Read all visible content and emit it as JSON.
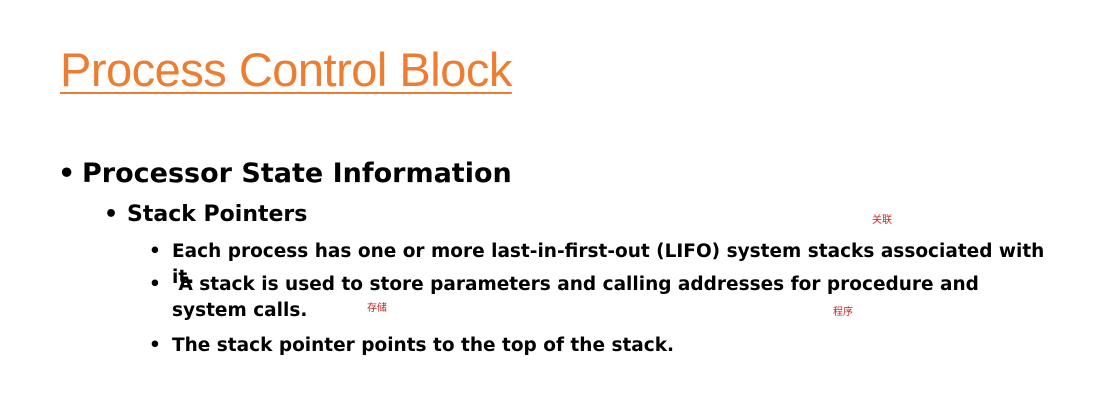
{
  "slide": {
    "title": "Process Control Block"
  },
  "colors": {
    "title": "#ED7D31",
    "body_text": "#000000",
    "annotation": "#CC2222"
  },
  "bullet_glyph": "•",
  "content": {
    "level1": "Processor State Information",
    "level2": "Stack Pointers",
    "level3": [
      "Each process has one or more last-in-first-out (LIFO) system stacks associated with it.",
      " A stack is used to store parameters and calling addresses for procedure and system calls.",
      "The stack pointer points to the top of the stack."
    ]
  },
  "annotations": [
    "关联",
    "存储",
    "程序"
  ]
}
